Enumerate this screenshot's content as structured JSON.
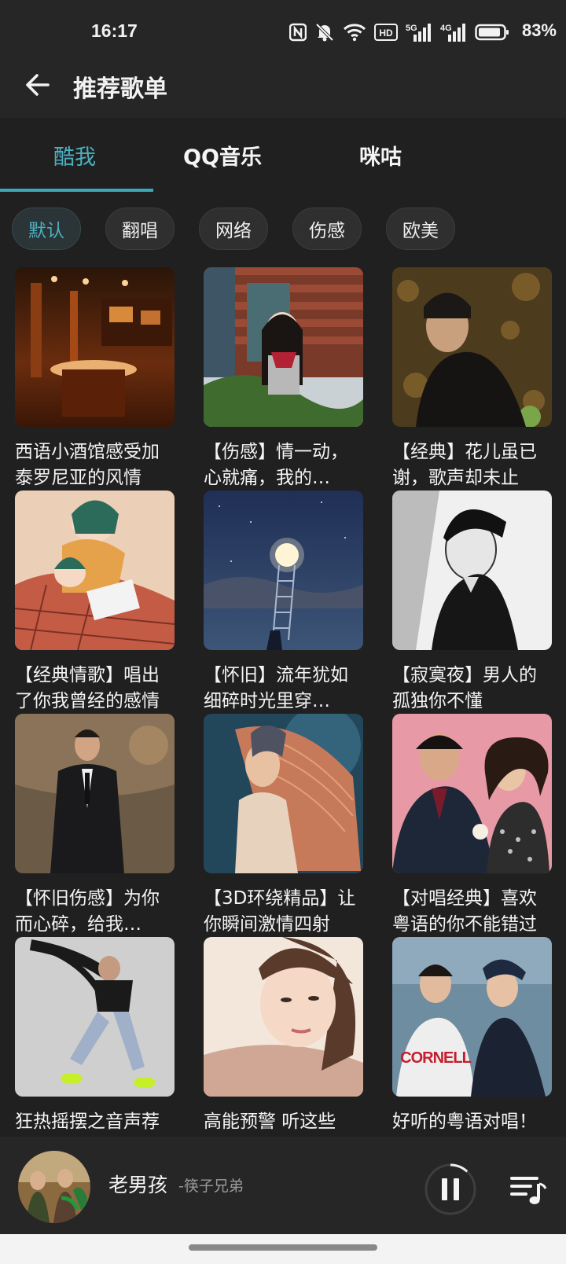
{
  "status": {
    "time": "16:17",
    "battery": "83%",
    "icons": [
      "nfc-icon",
      "mute-icon",
      "wifi-icon",
      "hd-icon",
      "signal-5g-icon",
      "signal-4g-icon",
      "battery-icon"
    ],
    "hd_label": "HD",
    "net_5g": "5G",
    "net_4g": "4G"
  },
  "header": {
    "title": "推荐歌单",
    "back_icon": "arrow-left-icon"
  },
  "tabs": [
    {
      "label": "酷我",
      "active": true
    },
    {
      "label": "QQ音乐",
      "active": false
    },
    {
      "label": "咪咕",
      "active": false
    }
  ],
  "chips": [
    {
      "label": "默认",
      "active": true
    },
    {
      "label": "翻唱",
      "active": false
    },
    {
      "label": "网络",
      "active": false
    },
    {
      "label": "伤感",
      "active": false
    },
    {
      "label": "欧美",
      "active": false
    }
  ],
  "playlists": [
    {
      "title": "西语小酒馆感受加泰罗尼亚的风情"
    },
    {
      "title": "【伤感】情一动，心就痛，我的…"
    },
    {
      "title": "【经典】花儿虽已谢，歌声却未止"
    },
    {
      "title": "【经典情歌】唱出了你我曾经的感情"
    },
    {
      "title": "【怀旧】流年犹如细碎时光里穿…"
    },
    {
      "title": "【寂寞夜】男人的孤独你不懂"
    },
    {
      "title": "【怀旧伤感】为你而心碎，给我…"
    },
    {
      "title": "【3D环绕精品】让你瞬间激情四射"
    },
    {
      "title": "【对唱经典】喜欢粤语的你不能错过"
    },
    {
      "title": "狂热摇摆之音声荐"
    },
    {
      "title": "高能预警 听这些"
    },
    {
      "title": "好听的粤语对唱！"
    }
  ],
  "player": {
    "song": "老男孩",
    "artist": "-筷子兄弟",
    "play_state": "playing",
    "play_icon": "pause-icon",
    "playlist_icon": "playlist-icon",
    "progress": 0.12
  },
  "colors": {
    "accent": "#4bb1c1",
    "background": "#202020",
    "header": "#262626"
  }
}
